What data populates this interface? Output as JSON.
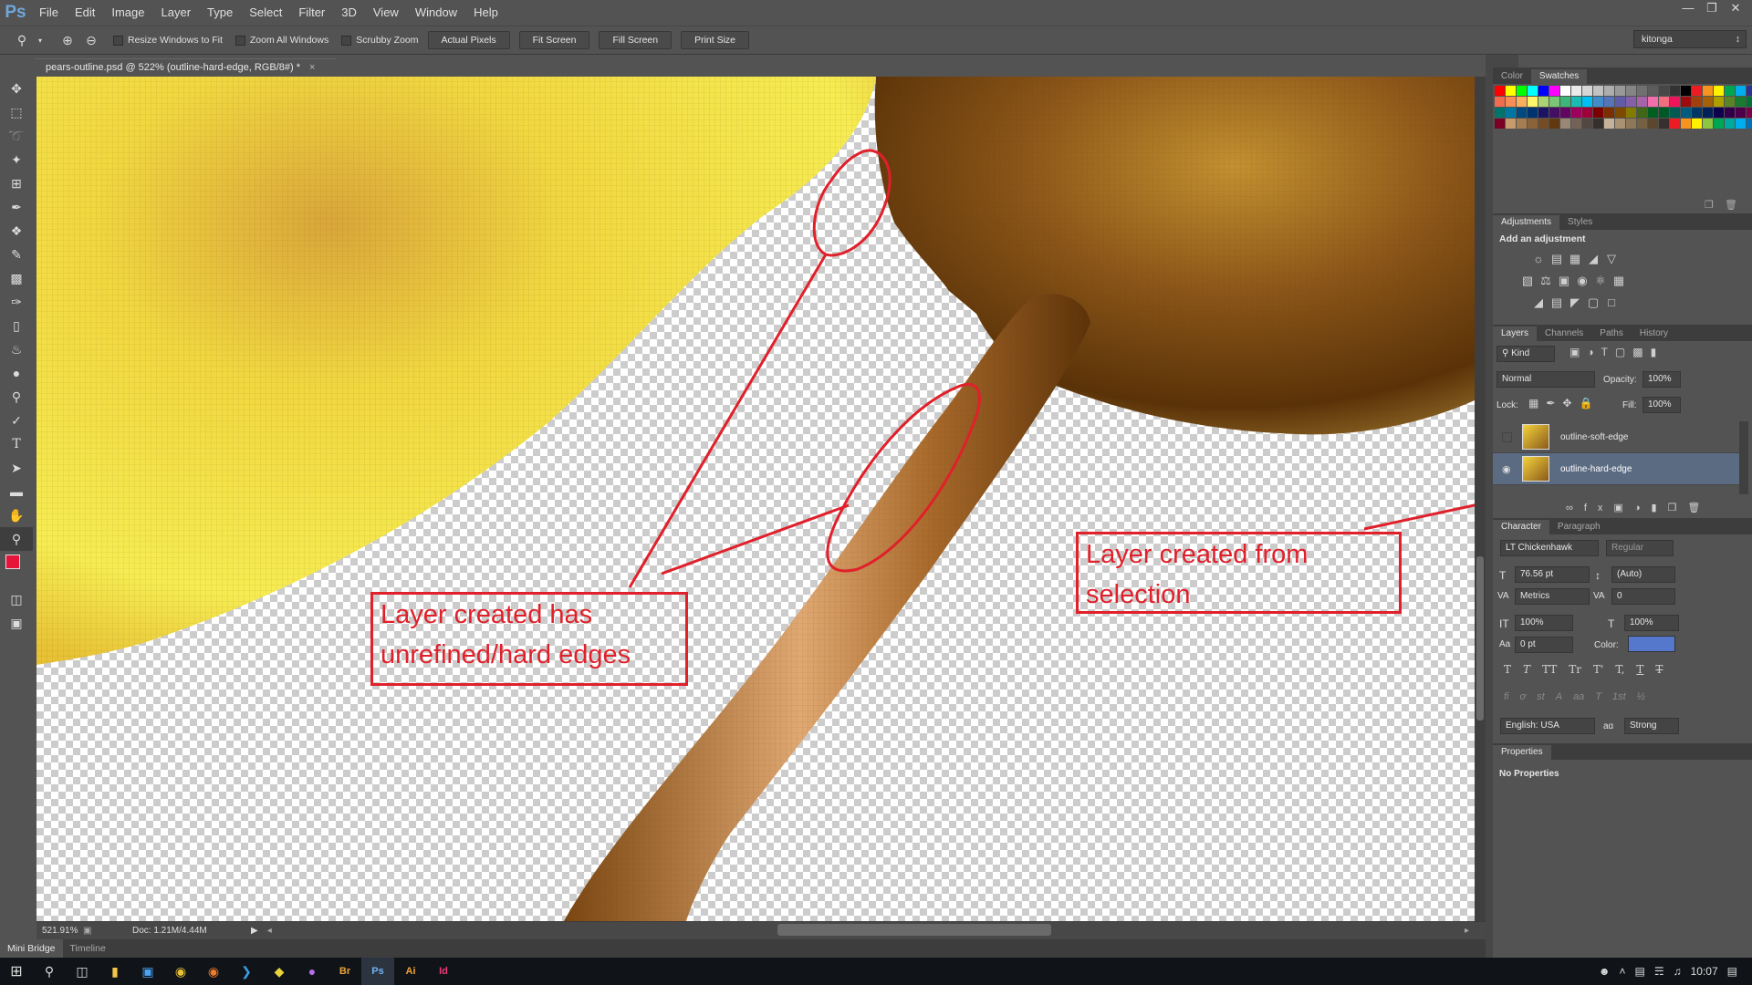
{
  "app": {
    "logo": "Ps",
    "menus": [
      "File",
      "Edit",
      "Image",
      "Layer",
      "Type",
      "Select",
      "Filter",
      "3D",
      "View",
      "Window",
      "Help"
    ]
  },
  "window_controls": [
    "minimize-icon",
    "restore-icon",
    "close-icon"
  ],
  "options": {
    "resize_windows": "Resize Windows to Fit",
    "zoom_all": "Zoom All Windows",
    "scrubby_zoom": "Scrubby Zoom",
    "actual_pixels": "Actual Pixels",
    "fit_screen": "Fit Screen",
    "fill_screen": "Fill Screen",
    "print_size": "Print Size",
    "workspace": "kitonga"
  },
  "document": {
    "tab_title": "pears-outline.psd @ 522% (outline-hard-edge, RGB/8#) *",
    "zoom": "521.91%",
    "doc_size": "Doc: 1.21M/4.44M"
  },
  "bottom_tabs": [
    "Mini Bridge",
    "Timeline"
  ],
  "annotations": {
    "left": [
      "Layer created has",
      "unrefined/hard edges"
    ],
    "right": [
      "Layer created from",
      "selection"
    ]
  },
  "swatches_panel": {
    "tabs": [
      "Color",
      "Swatches"
    ],
    "active": "Swatches",
    "colors": [
      "#ff0000",
      "#ffff00",
      "#00ff00",
      "#00ffff",
      "#0000ff",
      "#ff00ff",
      "#ffffff",
      "#ebebeb",
      "#d6d6d6",
      "#c2c2c2",
      "#adadad",
      "#999999",
      "#858585",
      "#707070",
      "#5c5c5c",
      "#474747",
      "#333333",
      "#000000",
      "#ed1c24",
      "#f7941d",
      "#fff200",
      "#00a651",
      "#00aeef",
      "#2e3192",
      "#f26c4f",
      "#f68e56",
      "#fbaf5d",
      "#fff568",
      "#acd373",
      "#7cc576",
      "#3bb878",
      "#1abbb4",
      "#00bff3",
      "#438ccb",
      "#5574b9",
      "#605ca8",
      "#855fa8",
      "#a763a8",
      "#f06eaa",
      "#f26d7d",
      "#ed145b",
      "#9e0b0f",
      "#a0410d",
      "#a36209",
      "#aba000",
      "#598527",
      "#1a7b30",
      "#007236",
      "#00746b",
      "#0076a3",
      "#004a80",
      "#003471",
      "#1b1464",
      "#440e62",
      "#630460",
      "#9e005d",
      "#9e0039",
      "#790000",
      "#7b2e00",
      "#7d4900",
      "#827b00",
      "#406618",
      "#005e20",
      "#005826",
      "#005952",
      "#005b7f",
      "#003663",
      "#002157",
      "#0d004c",
      "#32004b",
      "#4b0049",
      "#7b0046",
      "#7a0026",
      "#c69c6d",
      "#a67c52",
      "#8c6239",
      "#754c24",
      "#603913",
      "#998675",
      "#736357",
      "#534741",
      "#362f2d",
      "#c7b299",
      "#a99273",
      "#8f7759",
      "#766043",
      "#5c472e",
      "#362f2d",
      "#ed1c24",
      "#f7941d",
      "#fff200",
      "#8dc63f",
      "#00a651",
      "#00a99d",
      "#00aeef",
      "#0072bc"
    ]
  },
  "adjustments_panel": {
    "tabs": [
      "Adjustments",
      "Styles"
    ],
    "active": "Adjustments",
    "heading": "Add an adjustment"
  },
  "layers_panel": {
    "tabs": [
      "Layers",
      "Channels",
      "Paths",
      "History"
    ],
    "active": "Layers",
    "filter": "Kind",
    "blend_mode": "Normal",
    "opacity_label": "Opacity:",
    "opacity": "100%",
    "lock_label": "Lock:",
    "fill_label": "Fill:",
    "fill": "100%",
    "layers": [
      {
        "name": "outline-soft-edge",
        "visible": false,
        "selected": false
      },
      {
        "name": "outline-hard-edge",
        "visible": true,
        "selected": true
      }
    ]
  },
  "character_panel": {
    "tabs": [
      "Character",
      "Paragraph"
    ],
    "active": "Character",
    "font": "LT Chickenhawk",
    "style": "Regular",
    "size": "76.56 pt",
    "leading": "(Auto)",
    "kerning": "Metrics",
    "tracking": "0",
    "vscale": "100%",
    "hscale": "100%",
    "baseline": "0 pt",
    "color_label": "Color:",
    "color": "#5577cc",
    "type_buttons": [
      "T",
      "T",
      "TT",
      "Tr",
      "T'",
      "T,",
      "T",
      "T"
    ],
    "ot_buttons": [
      "fi",
      "ơ",
      "st",
      "A",
      "aa",
      "T",
      "1st",
      "½"
    ],
    "language": "English: USA",
    "aa_label": "aɑ",
    "antialias": "Strong"
  },
  "properties_panel": {
    "tab": "Properties",
    "text": "No Properties"
  },
  "taskbar": {
    "time": "10:07"
  }
}
